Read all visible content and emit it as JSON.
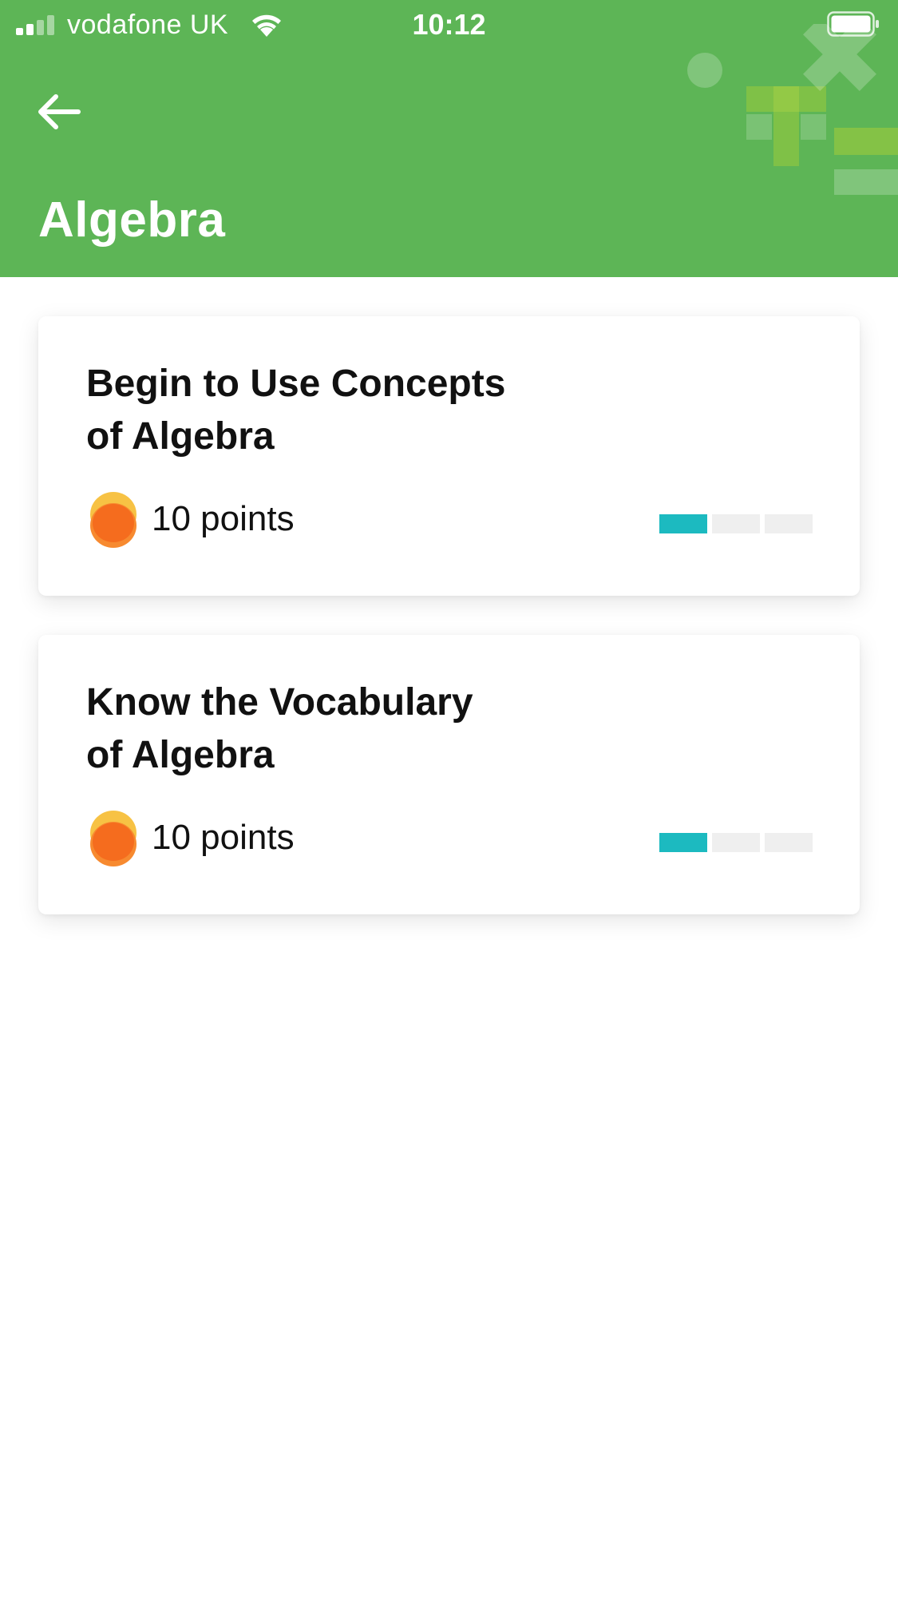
{
  "status_bar": {
    "carrier": "vodafone UK",
    "time": "10:12",
    "signal_bars_filled": 2,
    "signal_bars_total": 4
  },
  "header": {
    "title": "Algebra",
    "background_color": "#5db556",
    "back_icon": "arrow-left-icon",
    "decoration_icons": [
      "circle-shape",
      "plus-shape",
      "times-shape",
      "equals-shape"
    ]
  },
  "cards": [
    {
      "title_line1": "Begin to Use Concepts",
      "title_line2": "of Algebra",
      "points_label": "10 points",
      "points_icon": "coin-icon",
      "progress_completed": 1,
      "progress_total": 3
    },
    {
      "title_line1": "Know the Vocabulary",
      "title_line2": "of Algebra",
      "points_label": "10 points",
      "points_icon": "coin-icon",
      "progress_completed": 1,
      "progress_total": 3
    }
  ],
  "colors": {
    "progress_done": "#1cbac0",
    "progress_todo": "#efefef",
    "coin_top": "#f7c244",
    "coin_front": "#f56c1e"
  }
}
